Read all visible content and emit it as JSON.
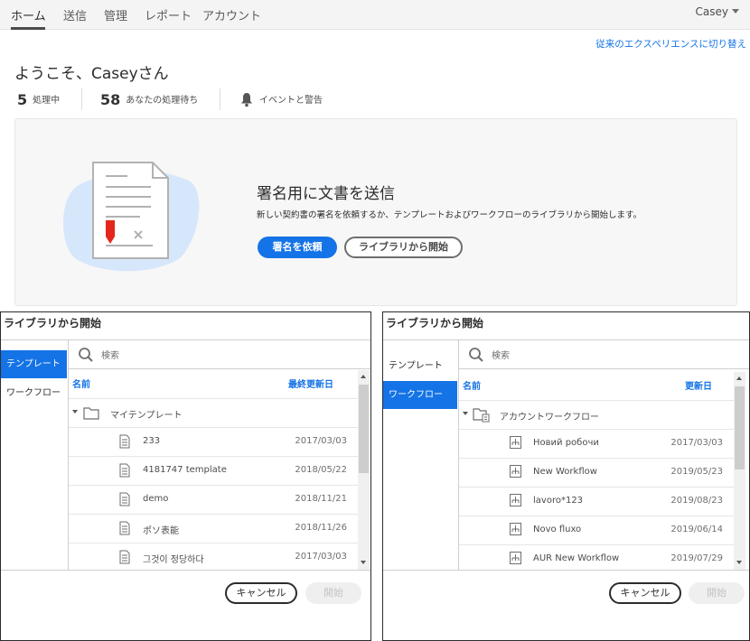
{
  "nav": {
    "tabs": [
      "ホーム",
      "送信",
      "管理",
      "レポート",
      "アカウント"
    ],
    "user": "Casey"
  },
  "switch_link": "従来のエクスペリエンスに切り替え",
  "welcome": "ようこそ、Caseyさん",
  "stats": {
    "in_progress_count": "5",
    "in_progress_label": "処理中",
    "waiting_count": "58",
    "waiting_label": "あなたの処理待ち",
    "events_label": "イベントと警告"
  },
  "hero": {
    "title": "署名用に文書を送信",
    "description": "新しい契約書の署名を依頼するか、テンプレートおよびワークフローのライブラリから開始します。",
    "primary_button": "署名を依頼",
    "secondary_button": "ライブラリから開始"
  },
  "dialog_left": {
    "title": "ライブラリから開始",
    "tabs": [
      "テンプレート",
      "ワークフロー"
    ],
    "search_placeholder": "検索",
    "col_name": "名前",
    "col_date": "最終更新日",
    "folder": "マイテンプレート",
    "rows": [
      {
        "name": "233",
        "date": "2017/03/03"
      },
      {
        "name": "4181747 template",
        "date": "2018/05/22"
      },
      {
        "name": "demo",
        "date": "2018/11/21"
      },
      {
        "name": "ポソ表能",
        "date": "2018/11/26"
      },
      {
        "name": "그것이 정당하다",
        "date": "2017/03/03"
      }
    ],
    "cancel": "キャンセル",
    "start": "開始"
  },
  "dialog_right": {
    "title": "ライブラリから開始",
    "tabs": [
      "テンプレート",
      "ワークフロー"
    ],
    "search_placeholder": "検索",
    "col_name": "名前",
    "col_date": "更新日",
    "folder": "アカウントワークフロー",
    "rows": [
      {
        "name": "Новий робочи",
        "date": "2017/03/03"
      },
      {
        "name": "New Workflow",
        "date": "2019/05/23"
      },
      {
        "name": "lavoro*123",
        "date": "2019/08/23"
      },
      {
        "name": "Novo fluxo",
        "date": "2019/06/14"
      },
      {
        "name": "AUR New Workflow",
        "date": "2019/07/29"
      }
    ],
    "cancel": "キャンセル",
    "start": "開始"
  },
  "colors": {
    "accent": "#1473e6",
    "nav_bg": "#f4f4f4",
    "hero_bg": "#f7f7f7"
  }
}
